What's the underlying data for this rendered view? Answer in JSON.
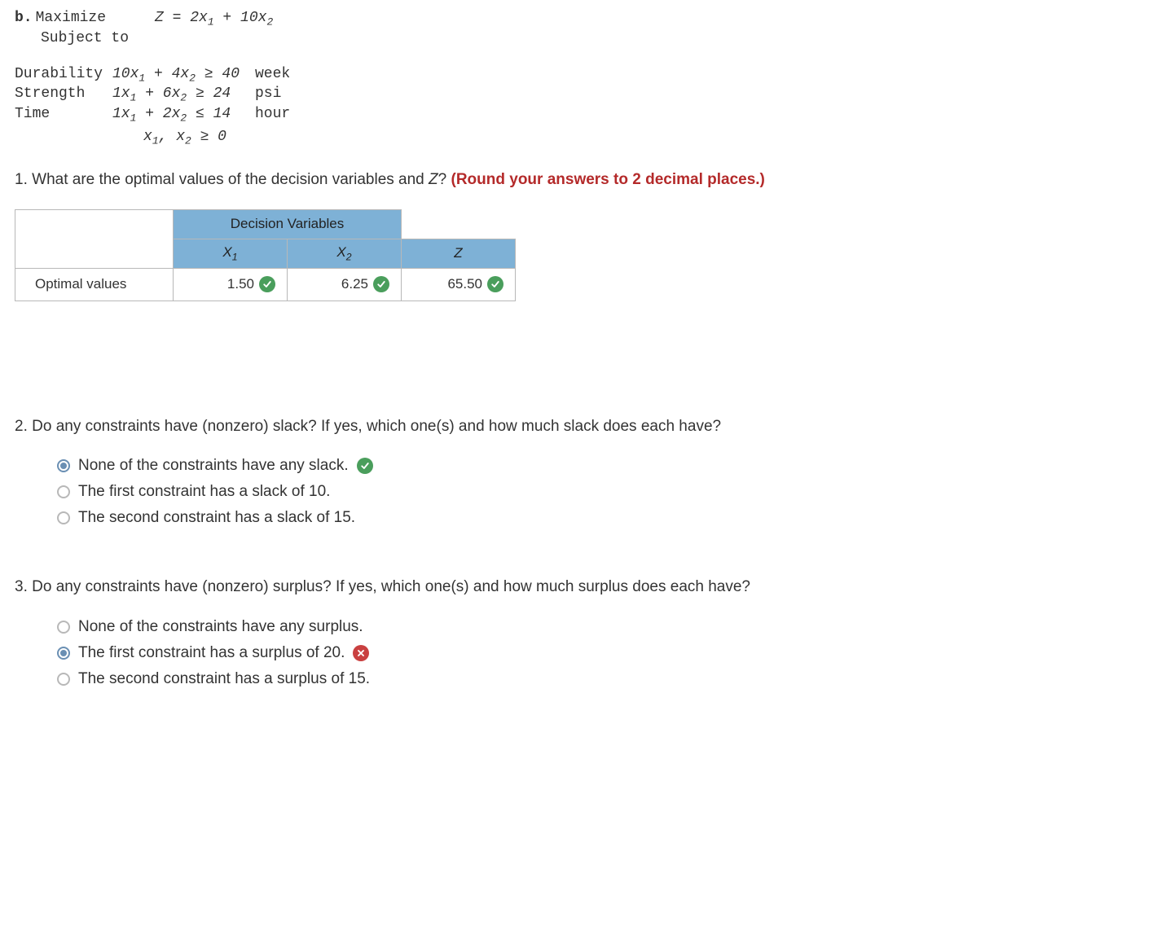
{
  "problem": {
    "part_label": "b.",
    "action": "Maximize",
    "objective_html": "Z = 2x<sub class='sub'>1</sub> + 10x<sub class='sub'>2</sub>",
    "subject_to": "Subject to",
    "constraints": [
      {
        "name": "Durability",
        "expr_html": "10x<sub class='sub'>1</sub> + 4x<sub class='sub'>2</sub> ≥ 40",
        "unit": "week"
      },
      {
        "name": "Strength",
        "expr_html": "1x<sub class='sub'>1</sub> + 6x<sub class='sub'>2</sub> ≥ 24",
        "unit": "psi"
      },
      {
        "name": "Time",
        "expr_html": "1x<sub class='sub'>1</sub> + 2x<sub class='sub'>2</sub> ≤ 14",
        "unit": "hour"
      }
    ],
    "nonneg_html": "x<sub class='sub'>1</sub>, x<sub class='sub'>2</sub> ≥ 0"
  },
  "q1": {
    "number": "1.",
    "text_before": "What are the optimal values of the decision variables and ",
    "z_var": "Z",
    "text_after": "? ",
    "hint": "(Round your answers to 2 decimal places.)",
    "table": {
      "group_header": "Decision Variables",
      "x1_label_html": "X<sub class='sub'>1</sub>",
      "x2_label_html": "X<sub class='sub'>2</sub>",
      "z_label": "Z",
      "row_label": "Optimal values",
      "x1_value": "1.50",
      "x2_value": "6.25",
      "z_value": "65.50",
      "x1_status": "correct",
      "x2_status": "correct",
      "z_status": "correct"
    }
  },
  "q2": {
    "number": "2.",
    "text": "Do any constraints have (nonzero) slack? If yes, which one(s) and how much slack does each have?",
    "options": [
      {
        "label": "None of the constraints have any slack.",
        "selected": true,
        "status": "correct"
      },
      {
        "label": "The first constraint has a slack of 10.",
        "selected": false,
        "status": null
      },
      {
        "label": "The second constraint has a slack of 15.",
        "selected": false,
        "status": null
      }
    ]
  },
  "q3": {
    "number": "3.",
    "text": "Do any constraints have (nonzero) surplus? If yes, which one(s) and how much surplus does each have?",
    "options": [
      {
        "label": "None of the constraints have any surplus.",
        "selected": false,
        "status": null
      },
      {
        "label": "The first constraint has a surplus of 20.",
        "selected": true,
        "status": "incorrect"
      },
      {
        "label": "The second constraint has a surplus of 15.",
        "selected": false,
        "status": null
      }
    ]
  }
}
